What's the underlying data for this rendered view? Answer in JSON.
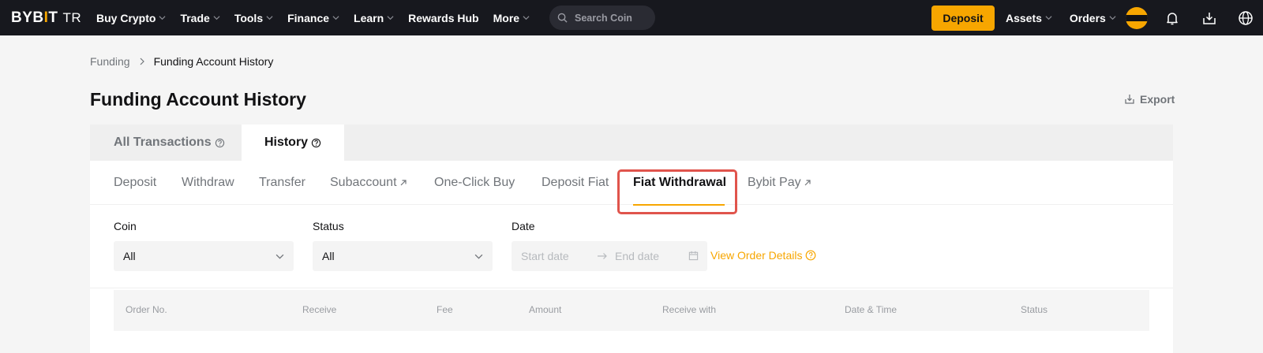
{
  "nav": {
    "logo_main": "BYB",
    "logo_i": "I",
    "logo_t": "T",
    "logo_region": "TR",
    "items": [
      {
        "label": "Buy Crypto",
        "has_dropdown": true
      },
      {
        "label": "Trade",
        "has_dropdown": true
      },
      {
        "label": "Tools",
        "has_dropdown": true
      },
      {
        "label": "Finance",
        "has_dropdown": true
      },
      {
        "label": "Learn",
        "has_dropdown": true
      },
      {
        "label": "Rewards Hub",
        "has_dropdown": false
      },
      {
        "label": "More",
        "has_dropdown": true
      }
    ],
    "search_placeholder": "Search Coin",
    "deposit_label": "Deposit",
    "assets_label": "Assets",
    "orders_label": "Orders",
    "icons": [
      "avatar",
      "bell-icon",
      "download-icon",
      "globe-icon"
    ]
  },
  "breadcrumb": {
    "parent": "Funding",
    "current": "Funding Account History"
  },
  "page": {
    "title": "Funding Account History",
    "export_label": "Export"
  },
  "main_tabs": [
    {
      "label": "All Transactions",
      "active": false
    },
    {
      "label": "History",
      "active": true
    }
  ],
  "sub_tabs": [
    {
      "label": "Deposit",
      "external": false,
      "active": false
    },
    {
      "label": "Withdraw",
      "external": false,
      "active": false
    },
    {
      "label": "Transfer",
      "external": false,
      "active": false
    },
    {
      "label": "Subaccount",
      "external": true,
      "active": false
    },
    {
      "label": "One-Click Buy",
      "external": false,
      "active": false
    },
    {
      "label": "Deposit Fiat",
      "external": false,
      "active": false
    },
    {
      "label": "Fiat Withdrawal",
      "external": false,
      "active": true
    },
    {
      "label": "Bybit Pay",
      "external": true,
      "active": false
    }
  ],
  "filters": {
    "coin_label": "Coin",
    "coin_value": "All",
    "status_label": "Status",
    "status_value": "All",
    "date_label": "Date",
    "start_placeholder": "Start date",
    "end_placeholder": "End date",
    "view_order_details": "View Order Details"
  },
  "table": {
    "columns": [
      "Order No.",
      "Receive",
      "Fee",
      "Amount",
      "Receive with",
      "Date & Time",
      "Status"
    ]
  },
  "colors": {
    "accent": "#f7a600",
    "nav_bg": "#17181e",
    "highlight": "#e0544c"
  }
}
